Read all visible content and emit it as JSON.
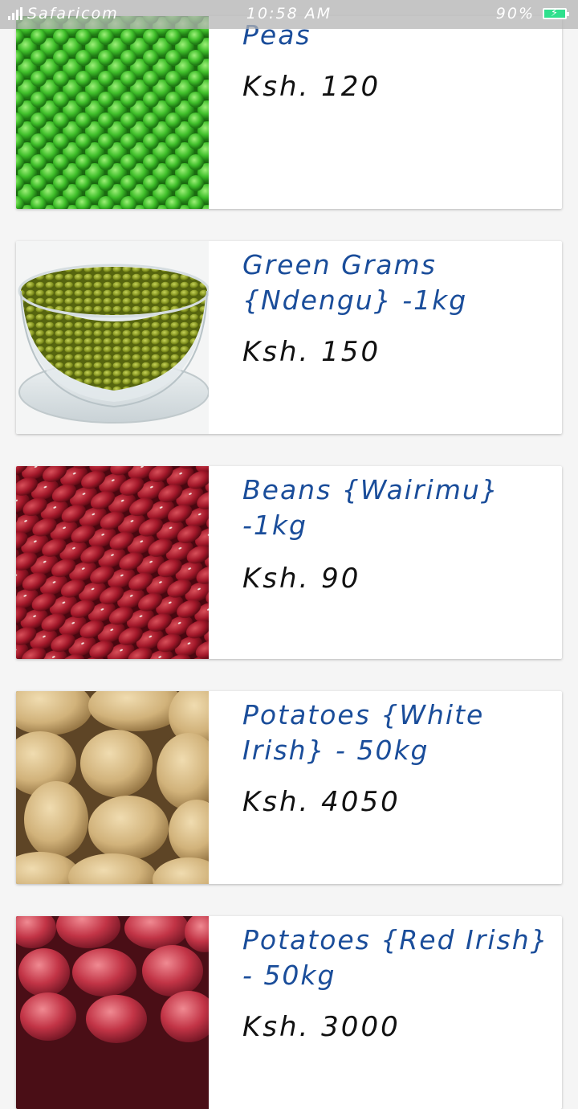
{
  "status_bar": {
    "carrier": "Safaricom",
    "time": "10:58 AM",
    "battery": "90%"
  },
  "products": [
    {
      "name": "Peas",
      "price": "Ksh. 120",
      "image": "peas-photo"
    },
    {
      "name": "Green Grams {Ndengu} -1kg",
      "price": "Ksh. 150",
      "image": "green-grams-photo"
    },
    {
      "name": "Beans {Wairimu} -1kg",
      "price": "Ksh. 90",
      "image": "red-beans-photo"
    },
    {
      "name": "Potatoes {White Irish} - 50kg",
      "price": "Ksh. 4050",
      "image": "white-potatoes-photo"
    },
    {
      "name": "Potatoes {Red Irish} - 50kg",
      "price": "Ksh. 3000",
      "image": "red-potatoes-photo"
    }
  ]
}
